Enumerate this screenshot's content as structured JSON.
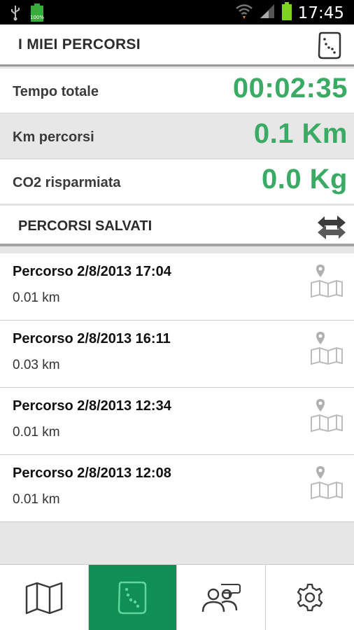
{
  "status_bar": {
    "time": "17:45",
    "battery_percent_label": "100%"
  },
  "header": {
    "title": "I MIEI PERCORSI",
    "icon": "route-card-icon"
  },
  "stats": [
    {
      "label": "Tempo totale",
      "value": "00:02:35"
    },
    {
      "label": "Km percorsi",
      "value": "0.1 Km"
    },
    {
      "label": "CO2 risparmiata",
      "value": "0.0 Kg"
    }
  ],
  "section": {
    "title": "PERCORSI SALVATI",
    "icon": "sort-arrows-icon"
  },
  "routes": [
    {
      "title": "Percorso 2/8/2013 17:04",
      "distance": "0.01 km"
    },
    {
      "title": "Percorso 2/8/2013 16:11",
      "distance": "0.03 km"
    },
    {
      "title": "Percorso 2/8/2013 12:34",
      "distance": "0.01 km"
    },
    {
      "title": "Percorso 2/8/2013 12:08",
      "distance": "0.01 km"
    }
  ],
  "tabs": [
    {
      "name": "map",
      "icon": "map-icon",
      "active": false
    },
    {
      "name": "routes",
      "icon": "route-card-icon",
      "active": true
    },
    {
      "name": "community",
      "icon": "people-chat-icon",
      "active": false
    },
    {
      "name": "settings",
      "icon": "gear-icon",
      "active": false
    }
  ],
  "colors": {
    "accent_green": "#3aaa65",
    "tab_active": "#0f8f55"
  }
}
